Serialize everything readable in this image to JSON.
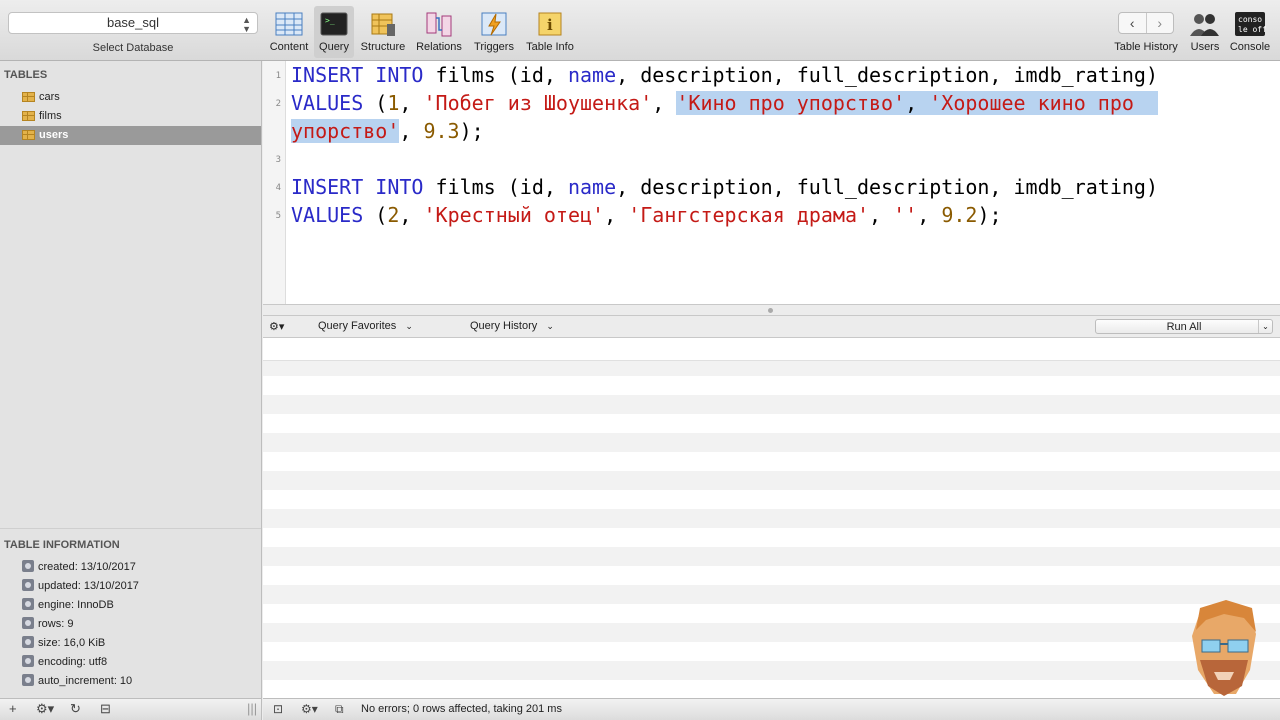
{
  "toolbar": {
    "database": "base_sql",
    "database_label": "Select Database",
    "buttons": [
      {
        "label": "Content"
      },
      {
        "label": "Query"
      },
      {
        "label": "Structure"
      },
      {
        "label": "Relations"
      },
      {
        "label": "Triggers"
      },
      {
        "label": "Table Info"
      }
    ],
    "right_buttons": [
      {
        "label": "Table History"
      },
      {
        "label": "Users"
      },
      {
        "label": "Console"
      }
    ]
  },
  "sidebar": {
    "tables_title": "TABLES",
    "tables": [
      "cars",
      "films",
      "users"
    ],
    "info_title": "TABLE INFORMATION",
    "info": [
      "created: 13/10/2017",
      "updated: 13/10/2017",
      "engine: InnoDB",
      "rows: 9",
      "size: 16,0 KiB",
      "encoding: utf8",
      "auto_increment: 10"
    ]
  },
  "editor": {
    "line_numbers": [
      "1",
      "2",
      "3",
      "4",
      "5"
    ],
    "line1": {
      "insert": "INSERT",
      "into": "INTO",
      "rest1": " films (id, ",
      "name": "name",
      "rest2": ", description, full_description, imdb_rating)"
    },
    "line2": {
      "values": "VALUES",
      "p1": " (",
      "n1": "1",
      "p2": ", ",
      "s1": "'Побег из Шоушенка'",
      "p3": ", ",
      "s2": "'Кино про упорство'",
      "p4": ", ",
      "s3a": "'Хорошее кино про"
    },
    "line2b": {
      "s3b": "упорство'",
      "p5": ", ",
      "n2": "9.3",
      "p6": ");"
    },
    "line4": {
      "insert": "INSERT",
      "into": "INTO",
      "rest1": " films (id, ",
      "name": "name",
      "rest2": ", description, full_description, imdb_rating)"
    },
    "line5": {
      "values": "VALUES",
      "p1": " (",
      "n1": "2",
      "p2": ", ",
      "s1": "'Крестный отец'",
      "p3": ", ",
      "s2": "'Гангстерская драма'",
      "p4": ", ",
      "s3": "''",
      "p5": ", ",
      "n2": "9.2",
      "p6": ");"
    }
  },
  "query_bar": {
    "favorites": "Query Favorites",
    "history": "Query History",
    "run_all": "Run All"
  },
  "status": {
    "message": "No errors; 0 rows affected, taking 201 ms"
  }
}
